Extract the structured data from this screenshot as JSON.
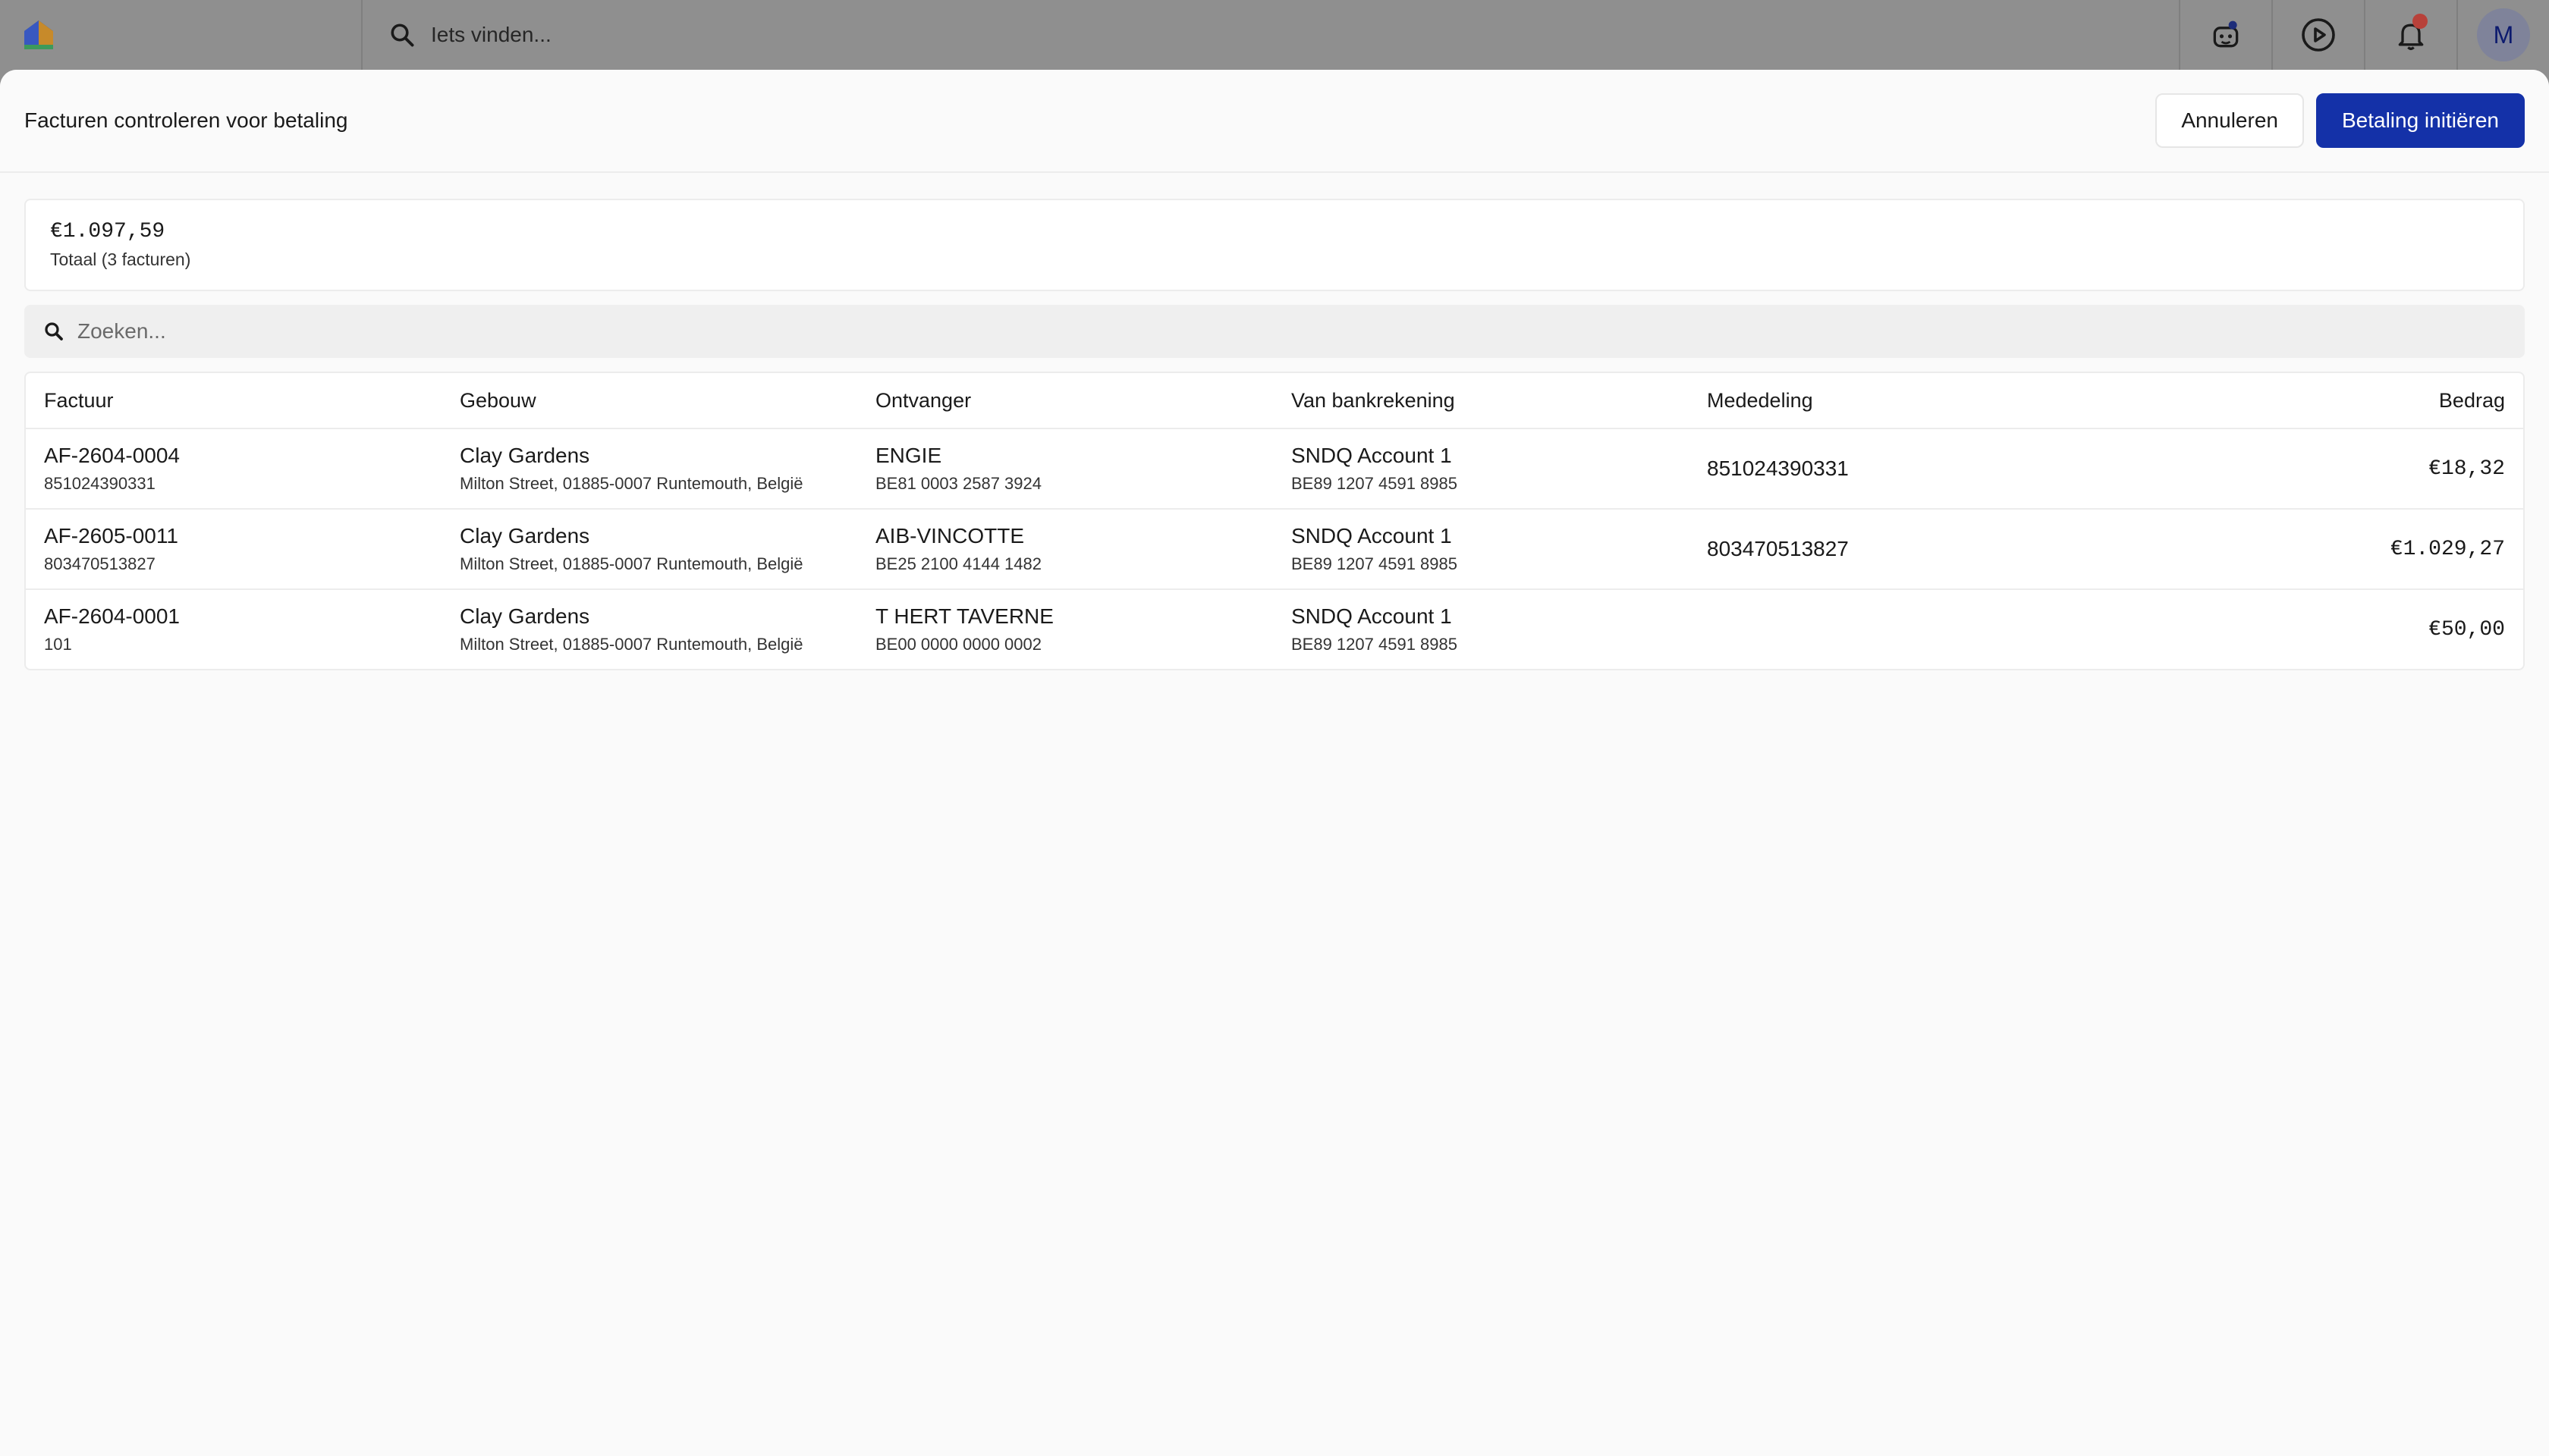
{
  "topbar": {
    "search_placeholder": "Iets vinden...",
    "avatar_initial": "M",
    "logo_icon": "house-logo-icon",
    "icons": [
      "search-icon",
      "assistant-bot-icon",
      "play-circle-icon",
      "bell-icon"
    ]
  },
  "modal": {
    "title": "Facturen controleren voor betaling",
    "cancel_label": "Annuleren",
    "primary_label": "Betaling initiëren"
  },
  "summary": {
    "amount": "€1.097,59",
    "label": "Totaal (3 facturen)"
  },
  "search": {
    "placeholder": "Zoeken..."
  },
  "table": {
    "headers": [
      "Factuur",
      "Gebouw",
      "Ontvanger",
      "Van bankrekening",
      "Mededeling",
      "Bedrag"
    ],
    "rows": [
      {
        "invoice": "AF-2604-0004",
        "invoice_ref": "851024390331",
        "building": "Clay Gardens",
        "address": "Milton Street, 01885-0007 Runtemouth, België",
        "recipient": "ENGIE",
        "recipient_iban": "BE81 0003 2587 3924",
        "account": "SNDQ Account 1",
        "account_iban": "BE89 1207 4591 8985",
        "message": "851024390331",
        "amount": "€18,32"
      },
      {
        "invoice": "AF-2605-0011",
        "invoice_ref": "803470513827",
        "building": "Clay Gardens",
        "address": "Milton Street, 01885-0007 Runtemouth, België",
        "recipient": "AIB-VINCOTTE",
        "recipient_iban": "BE25 2100 4144 1482",
        "account": "SNDQ Account 1",
        "account_iban": "BE89 1207 4591 8985",
        "message": "803470513827",
        "amount": "€1.029,27"
      },
      {
        "invoice": "AF-2604-0001",
        "invoice_ref": "101",
        "building": "Clay Gardens",
        "address": "Milton Street, 01885-0007 Runtemouth, België",
        "recipient": "T HERT TAVERNE",
        "recipient_iban": "BE00 0000 0000 0002",
        "account": "SNDQ Account 1",
        "account_iban": "BE89 1207 4591 8985",
        "message": "",
        "amount": "€50,00"
      }
    ]
  },
  "colors": {
    "primary": "#1431a8",
    "notification_dot": "#b8413a"
  }
}
